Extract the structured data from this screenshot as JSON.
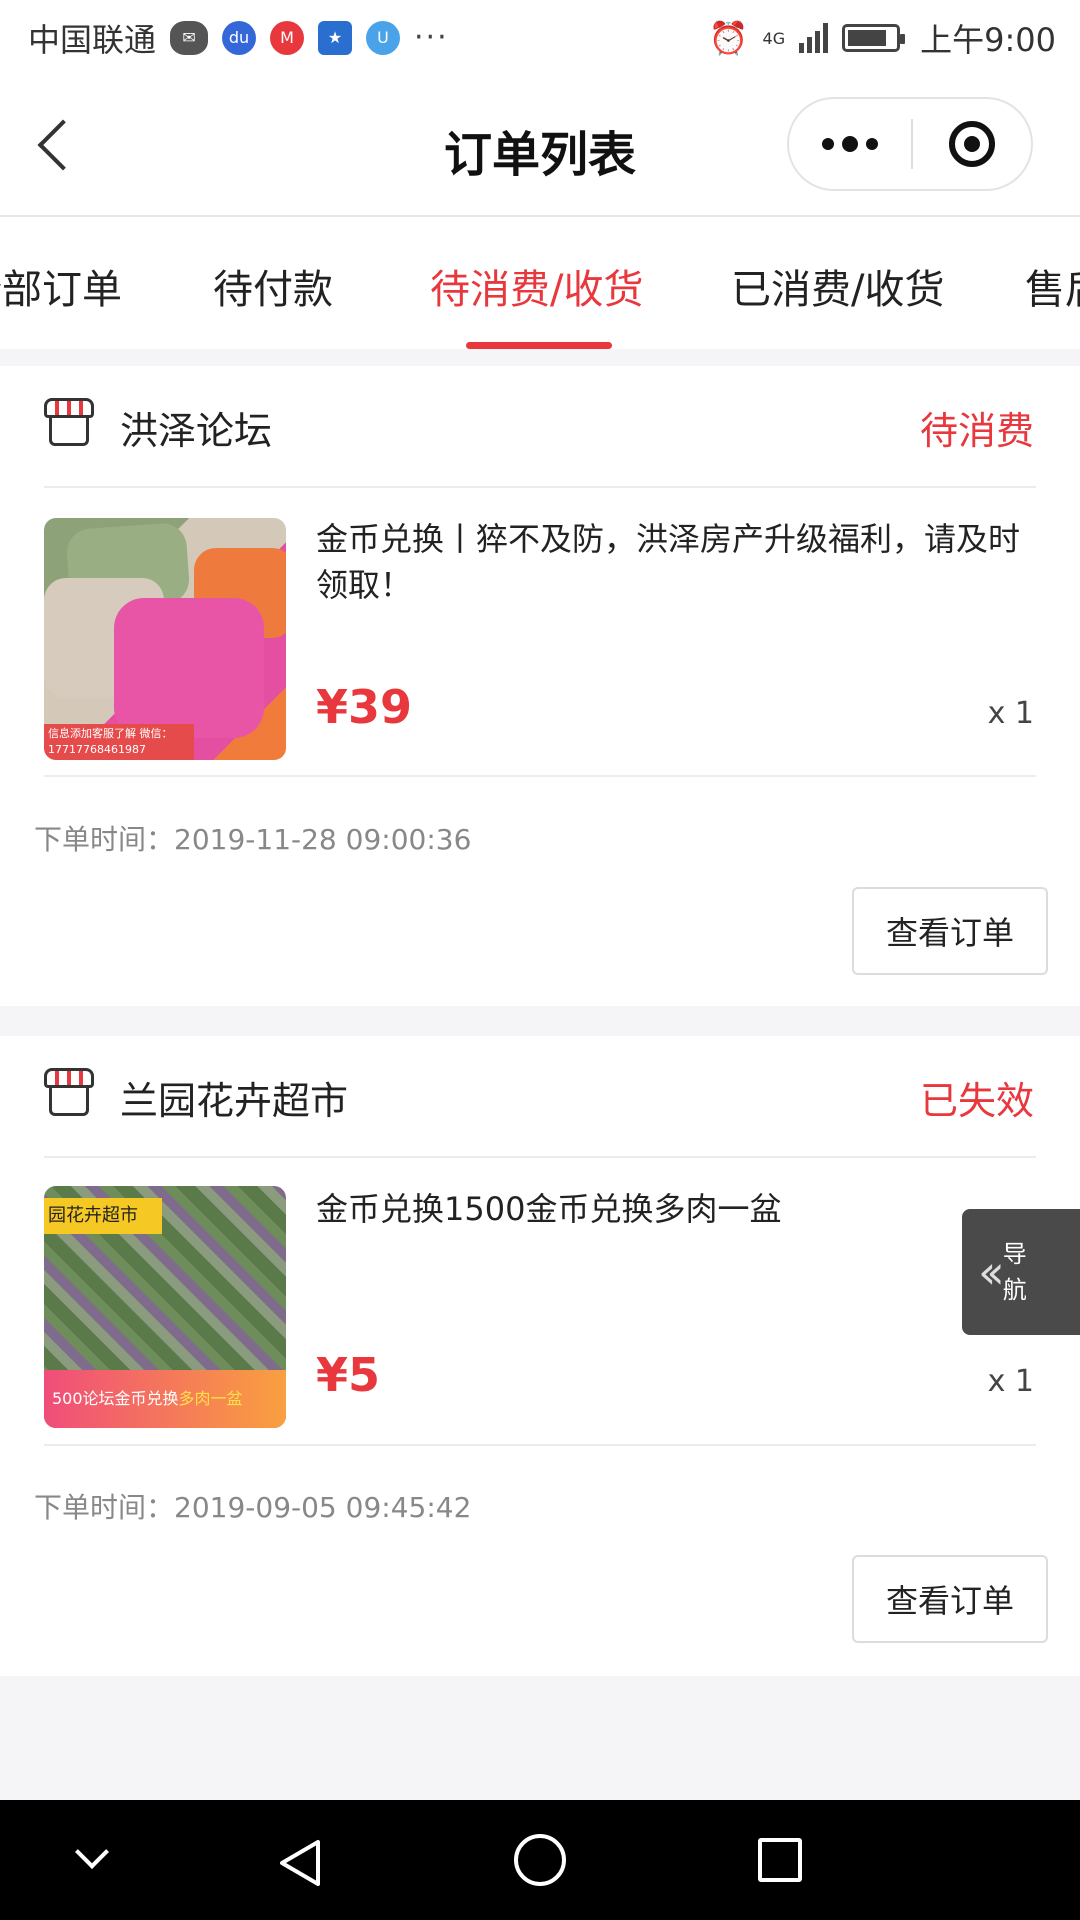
{
  "status_bar": {
    "carrier": "中国联通",
    "more": "···",
    "network": "4G",
    "time": "上午9:00"
  },
  "nav": {
    "title": "订单列表"
  },
  "tabs": [
    {
      "label": "全部订单"
    },
    {
      "label": "待付款"
    },
    {
      "label": "待消费/收货",
      "active": true
    },
    {
      "label": "已消费/收货"
    },
    {
      "label": "售后"
    }
  ],
  "orders": [
    {
      "shop_name": "洪泽论坛",
      "status": "待消费",
      "product_name": "金币兑换丨猝不及防，洪泽房产升级福利，请及时领取！",
      "price": "¥39",
      "quantity": "x 1",
      "time_label": "下单时间：",
      "time": "2019-11-28 09:00:36",
      "button": "查看订单",
      "thumb_text": "信息添加客服了解 微信：17717768461987"
    },
    {
      "shop_name": "兰园花卉超市",
      "status": "已失效",
      "product_name": "金币兑换1500金币兑换多肉一盆",
      "price": "¥5",
      "quantity": "x 1",
      "time_label": "下单时间：",
      "time": "2019-09-05 09:45:42",
      "button": "查看订单",
      "thumb_banner": "园花卉超市",
      "thumb_footer_a": "500论坛金币兑换",
      "thumb_footer_b": "多肉一盆"
    }
  ],
  "float_nav": {
    "label": "导航"
  },
  "colors": {
    "accent": "#e8383d",
    "background": "#f5f5f7"
  }
}
